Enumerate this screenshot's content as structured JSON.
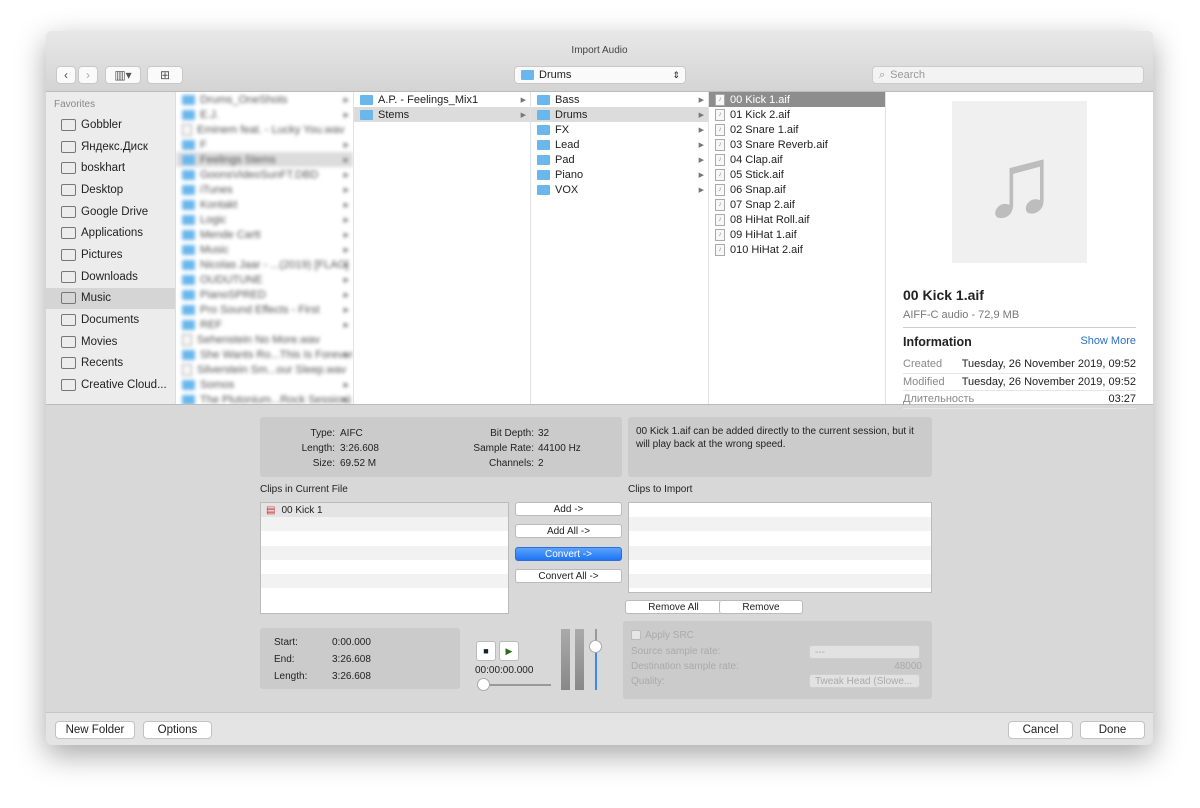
{
  "window": {
    "title": "Import Audio"
  },
  "toolbar": {
    "back": "‹",
    "forward": "›",
    "view": "▥▾",
    "new_folder_icon": "folder-plus",
    "path": "Drums",
    "search_placeholder": "Search"
  },
  "sidebar": {
    "heading": "Favorites",
    "items": [
      {
        "label": "Gobbler"
      },
      {
        "label": "Яндекс.Диск"
      },
      {
        "label": "boskhart"
      },
      {
        "label": "Desktop"
      },
      {
        "label": "Google Drive"
      },
      {
        "label": "Applications"
      },
      {
        "label": "Pictures"
      },
      {
        "label": "Downloads"
      },
      {
        "label": "Music",
        "selected": true
      },
      {
        "label": "Documents"
      },
      {
        "label": "Movies"
      },
      {
        "label": "Recents"
      },
      {
        "label": "Creative Cloud..."
      }
    ]
  },
  "columns": {
    "col1": [
      "Drums_OneShots",
      "E.J.",
      "Eminem feat. - Lucky You.wav",
      "F",
      "Feelings Stems",
      "GoonsVideoSunFT.DBD",
      "iTunes",
      "Kontakt",
      "Logic",
      "Mende Cartt",
      "Music",
      "Nicolas Jaar - ...(2019) [FLAC]",
      "OUDUTUNE",
      "PianoSPRED",
      "Pro Sound Effects - First",
      "REF",
      "Sehenstein No More.wav",
      "She Wants Ro...This Is Forever",
      "Silverstein Sm...our Sleep.wav",
      "Somos",
      "The Plutonium...Rock Session)"
    ],
    "col2": [
      "A.P. - Feelings_Mix1",
      "Stems"
    ],
    "col3": [
      "Bass",
      "Drums",
      "FX",
      "Lead",
      "Pad",
      "Piano",
      "VOX"
    ],
    "col4": [
      "00 Kick 1.aif",
      "01 Kick 2.aif",
      "02 Snare 1.aif",
      "03 Snare Reverb.aif",
      "04 Clap.aif",
      "05 Stick.aif",
      "06 Snap.aif",
      "07 Snap 2.aif",
      "08 HiHat Roll.aif",
      "09 HiHat 1.aif",
      "010 HiHat 2.aif"
    ]
  },
  "preview": {
    "name": "00 Kick 1.aif",
    "kind": "AIFF-C audio - 72,9 MB",
    "info_heading": "Information",
    "show_more": "Show More",
    "rows": [
      {
        "k": "Created",
        "v": "Tuesday, 26 November 2019, 09:52"
      },
      {
        "k": "Modified",
        "v": "Tuesday, 26 November 2019, 09:52"
      },
      {
        "k": "Длительность",
        "v": "03:27"
      }
    ]
  },
  "fileinfo": {
    "type_l": "Type:",
    "type": "AIFC",
    "length_l": "Length:",
    "length": "3:26.608",
    "size_l": "Size:",
    "size": "69.52 M",
    "bit_l": "Bit Depth:",
    "bit": "32",
    "rate_l": "Sample Rate:",
    "rate": "44100 Hz",
    "ch_l": "Channels:",
    "ch": "2"
  },
  "message": "00 Kick 1.aif can be added directly to the current session, but it will play back at the wrong speed.",
  "clips": {
    "current_label": "Clips in Current File",
    "current": [
      "00 Kick 1"
    ],
    "import_label": "Clips to Import",
    "add": "Add ->",
    "add_all": "Add All ->",
    "convert": "Convert ->",
    "convert_all": "Convert All ->",
    "remove_all": "Remove All",
    "remove": "Remove"
  },
  "range": {
    "start_l": "Start:",
    "start": "0:00.000",
    "end_l": "End:",
    "end": "3:26.608",
    "len_l": "Length:",
    "len": "3:26.608"
  },
  "transport": {
    "time": "00:00:00.000",
    "position": 0,
    "volume": 0.7
  },
  "src": {
    "apply": "Apply SRC",
    "source_l": "Source sample rate:",
    "source": "---",
    "dest_l": "Destination sample rate:",
    "dest": "48000",
    "quality_l": "Quality:",
    "quality": "Tweak Head (Slowe..."
  },
  "footer": {
    "new_folder": "New Folder",
    "options": "Options",
    "cancel": "Cancel",
    "done": "Done"
  },
  "colors": {
    "accent": "#1f74f2",
    "folder": "#6ab7ec"
  }
}
